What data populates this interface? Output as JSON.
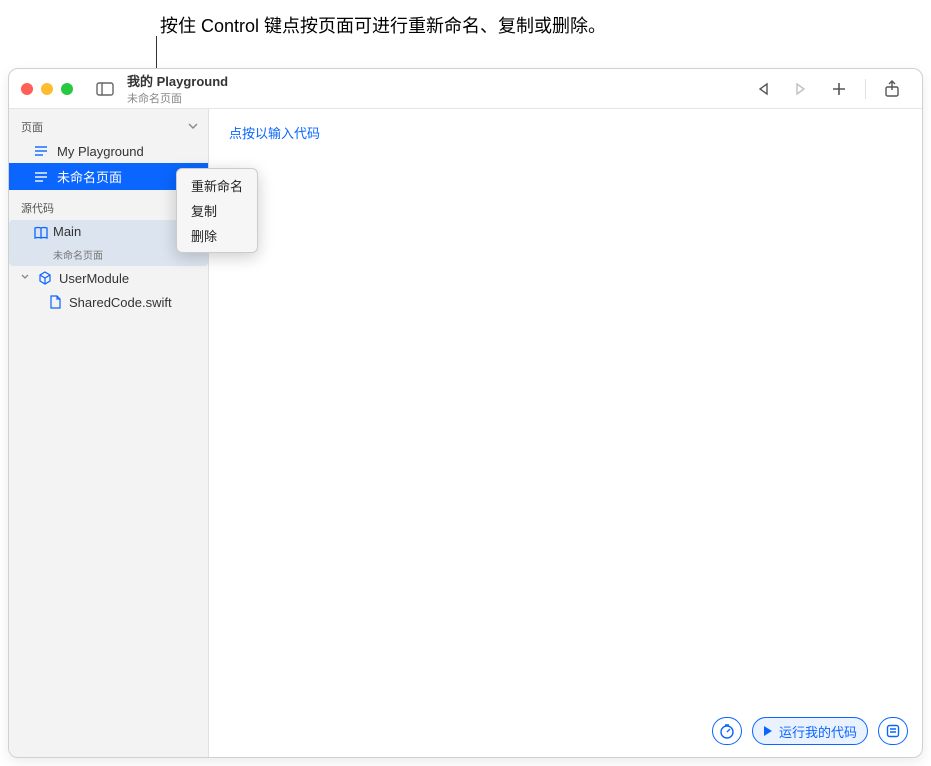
{
  "annotation": "按住 Control 键点按页面可进行重新命名、复制或删除。",
  "titlebar": {
    "title": "我的 Playground",
    "subtitle": "未命名页面"
  },
  "sidebar": {
    "pages_header": "页面",
    "pages": [
      {
        "name": "My Playground",
        "selected": false
      },
      {
        "name": "未命名页面",
        "selected": true
      }
    ],
    "source_header": "源代码",
    "main_item": {
      "name": "Main",
      "subtitle": "未命名页面"
    },
    "module": {
      "name": "UserModule"
    },
    "files": [
      {
        "name": "SharedCode.swift"
      }
    ]
  },
  "context_menu": {
    "items": [
      "重新命名",
      "复制",
      "删除"
    ]
  },
  "editor": {
    "placeholder": "点按以输入代码"
  },
  "bottom_bar": {
    "run_label": "运行我的代码"
  }
}
